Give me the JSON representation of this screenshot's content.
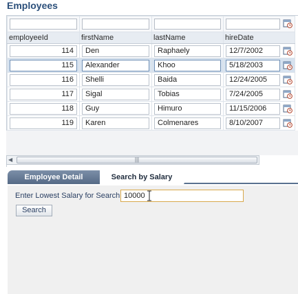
{
  "page": {
    "title": "Employees"
  },
  "table": {
    "columns": [
      "employeeId",
      "firstName",
      "lastName",
      "hireDate"
    ],
    "rows": [
      {
        "employeeId": "114",
        "firstName": "Den",
        "lastName": "Raphaely",
        "hireDate": "12/7/2002"
      },
      {
        "employeeId": "115",
        "firstName": "Alexander",
        "lastName": "Khoo",
        "hireDate": "5/18/2003"
      },
      {
        "employeeId": "116",
        "firstName": "Shelli",
        "lastName": "Baida",
        "hireDate": "12/24/2005"
      },
      {
        "employeeId": "117",
        "firstName": "Sigal",
        "lastName": "Tobias",
        "hireDate": "7/24/2005"
      },
      {
        "employeeId": "118",
        "firstName": "Guy",
        "lastName": "Himuro",
        "hireDate": "11/15/2006"
      },
      {
        "employeeId": "119",
        "firstName": "Karen",
        "lastName": "Colmenares",
        "hireDate": "8/10/2007"
      }
    ],
    "selected_row_index": 1
  },
  "tabs": [
    {
      "label": "Employee Detail",
      "active": false
    },
    {
      "label": "Search by Salary",
      "active": true
    }
  ],
  "search": {
    "label": "Enter Lowest Salary for Search",
    "value": "10000",
    "button_label": "Search"
  },
  "colors": {
    "title": "#2b4f7a",
    "tab_active_border": "#59718f",
    "input_focus": "#d8a84a",
    "selected_row": "#d6e2ef"
  },
  "icons": {
    "date_picker": "calendar-icon",
    "scroll_left": "arrow-left-icon",
    "scroll_grip": "scroll-grip-icon",
    "cursor": "text-cursor-icon"
  }
}
